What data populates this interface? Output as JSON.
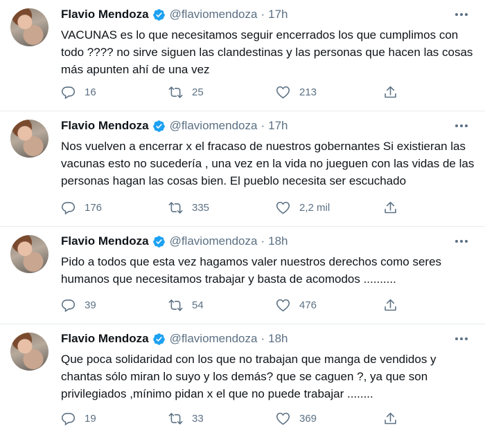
{
  "tweets": [
    {
      "name": "Flavio Mendoza",
      "handle": "@flaviomendoza",
      "separator": "·",
      "time": "17h",
      "text": "VACUNAS es lo que necesitamos seguir encerrados los que cumplimos con todo ???? no sirve siguen las clandestinas y las personas que hacen las cosas más apunten ahí de una vez",
      "replies": "16",
      "retweets": "25",
      "likes": "213"
    },
    {
      "name": "Flavio Mendoza",
      "handle": "@flaviomendoza",
      "separator": "·",
      "time": "17h",
      "text": "Nos vuelven a encerrar x el fracaso de nuestros gobernantes Si existieran las vacunas esto no sucedería , una vez en la vida no jueguen con las vidas de las personas hagan las cosas bien. El pueblo necesita ser escuchado",
      "replies": "176",
      "retweets": "335",
      "likes": "2,2 mil"
    },
    {
      "name": "Flavio Mendoza",
      "handle": "@flaviomendoza",
      "separator": "·",
      "time": "18h",
      "text": "Pido a todos que esta vez hagamos valer nuestros derechos como seres humanos que necesitamos trabajar y basta de acomodos ..........",
      "replies": "39",
      "retweets": "54",
      "likes": "476"
    },
    {
      "name": "Flavio Mendoza",
      "handle": "@flaviomendoza",
      "separator": "·",
      "time": "18h",
      "text": "Que poca solidaridad con los que no trabajan que manga de vendidos y chantas sólo miran lo suyo y los demás? que se caguen ?, ya que son privilegiados ,mínimo pidan x el que no puede trabajar ........",
      "replies": "19",
      "retweets": "33",
      "likes": "369"
    }
  ],
  "icons": {
    "verified": "verified-badge-icon",
    "reply": "reply-icon",
    "retweet": "retweet-icon",
    "like": "heart-icon",
    "share": "share-icon",
    "more": "more-options-icon"
  },
  "colors": {
    "verified": "#1da1f2",
    "secondary_text": "#5b7083",
    "divider": "#e6ecf0"
  }
}
